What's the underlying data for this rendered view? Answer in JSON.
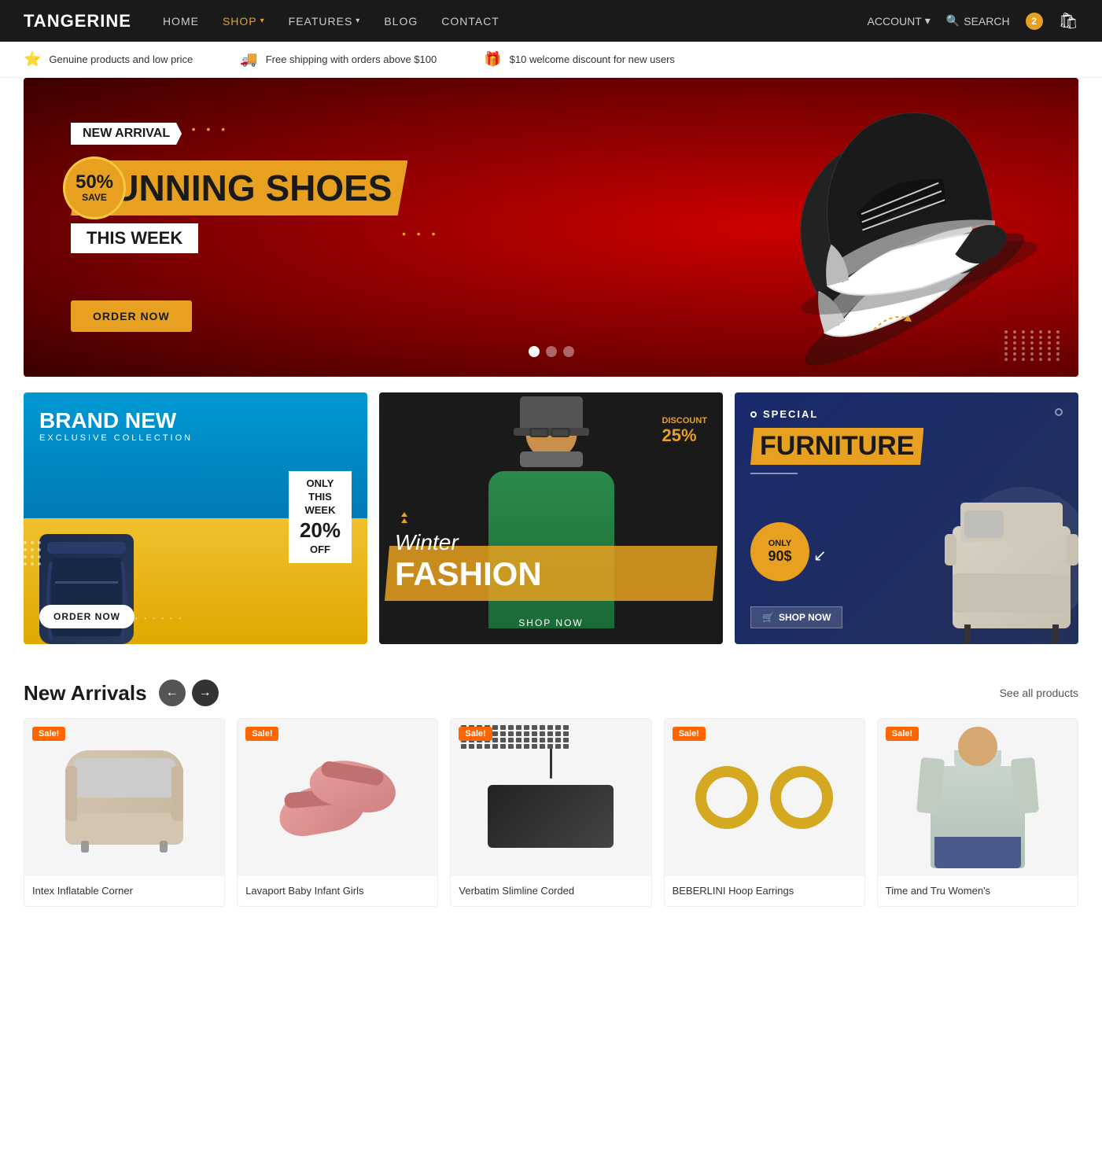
{
  "brand": "TANGERINE",
  "nav": {
    "links": [
      {
        "label": "HOME",
        "href": "#",
        "active": false
      },
      {
        "label": "SHOP",
        "href": "#",
        "active": true,
        "hasDropdown": true
      },
      {
        "label": "FEATURES",
        "href": "#",
        "active": false,
        "hasDropdown": true
      },
      {
        "label": "BLOG",
        "href": "#",
        "active": false
      },
      {
        "label": "CONTACT",
        "href": "#",
        "active": false
      }
    ],
    "account_label": "ACCOUNT",
    "search_label": "SEARCH",
    "cart_count": "2"
  },
  "info_bar": {
    "items": [
      {
        "icon": "⭐",
        "text": "Genuine products and low price"
      },
      {
        "icon": "🚚",
        "text": "Free shipping with orders above $100"
      },
      {
        "icon": "🎁",
        "text": "$10 welcome discount for new users"
      }
    ]
  },
  "hero": {
    "tag": "NEW ARRIVAL",
    "title": "RUNNING SHOES",
    "subtitle": "THIS WEEK",
    "cta": "ORDER NOW",
    "save_percent": "50%",
    "save_label": "SAVE",
    "dots": [
      true,
      false,
      false
    ]
  },
  "promo_cards": [
    {
      "tag": "BRAND NEW",
      "sub": "EXCLUSIVE COLLECTION",
      "badge_line1": "ONLY",
      "badge_line2": "THIS",
      "badge_line3": "WEEK",
      "discount": "20%",
      "discount_unit": "OFF",
      "cta": "ORDER NOW"
    },
    {
      "discount_label": "DISCOUNT",
      "discount_value": "25%",
      "title_italic": "Winter",
      "title_bold": "FASHION",
      "cta": "SHOP NOW"
    },
    {
      "tag": "SPECIAL",
      "title": "FURNITURE",
      "only_label": "ONLY",
      "only_price": "90$",
      "cta": "SHOP NOW"
    }
  ],
  "new_arrivals": {
    "section_title": "New Arrivals",
    "nav_left": "←",
    "nav_right": "→",
    "see_all": "See all products",
    "products": [
      {
        "name": "Intex Inflatable Corner",
        "sale": "Sale!",
        "img_type": "sofa"
      },
      {
        "name": "Lavaport Baby Infant Girls",
        "sale": "Sale!",
        "img_type": "slippers"
      },
      {
        "name": "Verbatim Slimline Corded",
        "sale": "Sale!",
        "img_type": "keyboard"
      },
      {
        "name": "BEBERLINI Hoop Earrings",
        "sale": "Sale!",
        "img_type": "earrings"
      },
      {
        "name": "Time and Tru Women's",
        "sale": "Sale!",
        "img_type": "sweater"
      }
    ]
  },
  "colors": {
    "accent": "#e8a020",
    "dark": "#1a1a1a",
    "sale_badge": "#ff6600",
    "hero_bg": "#8b0000"
  }
}
